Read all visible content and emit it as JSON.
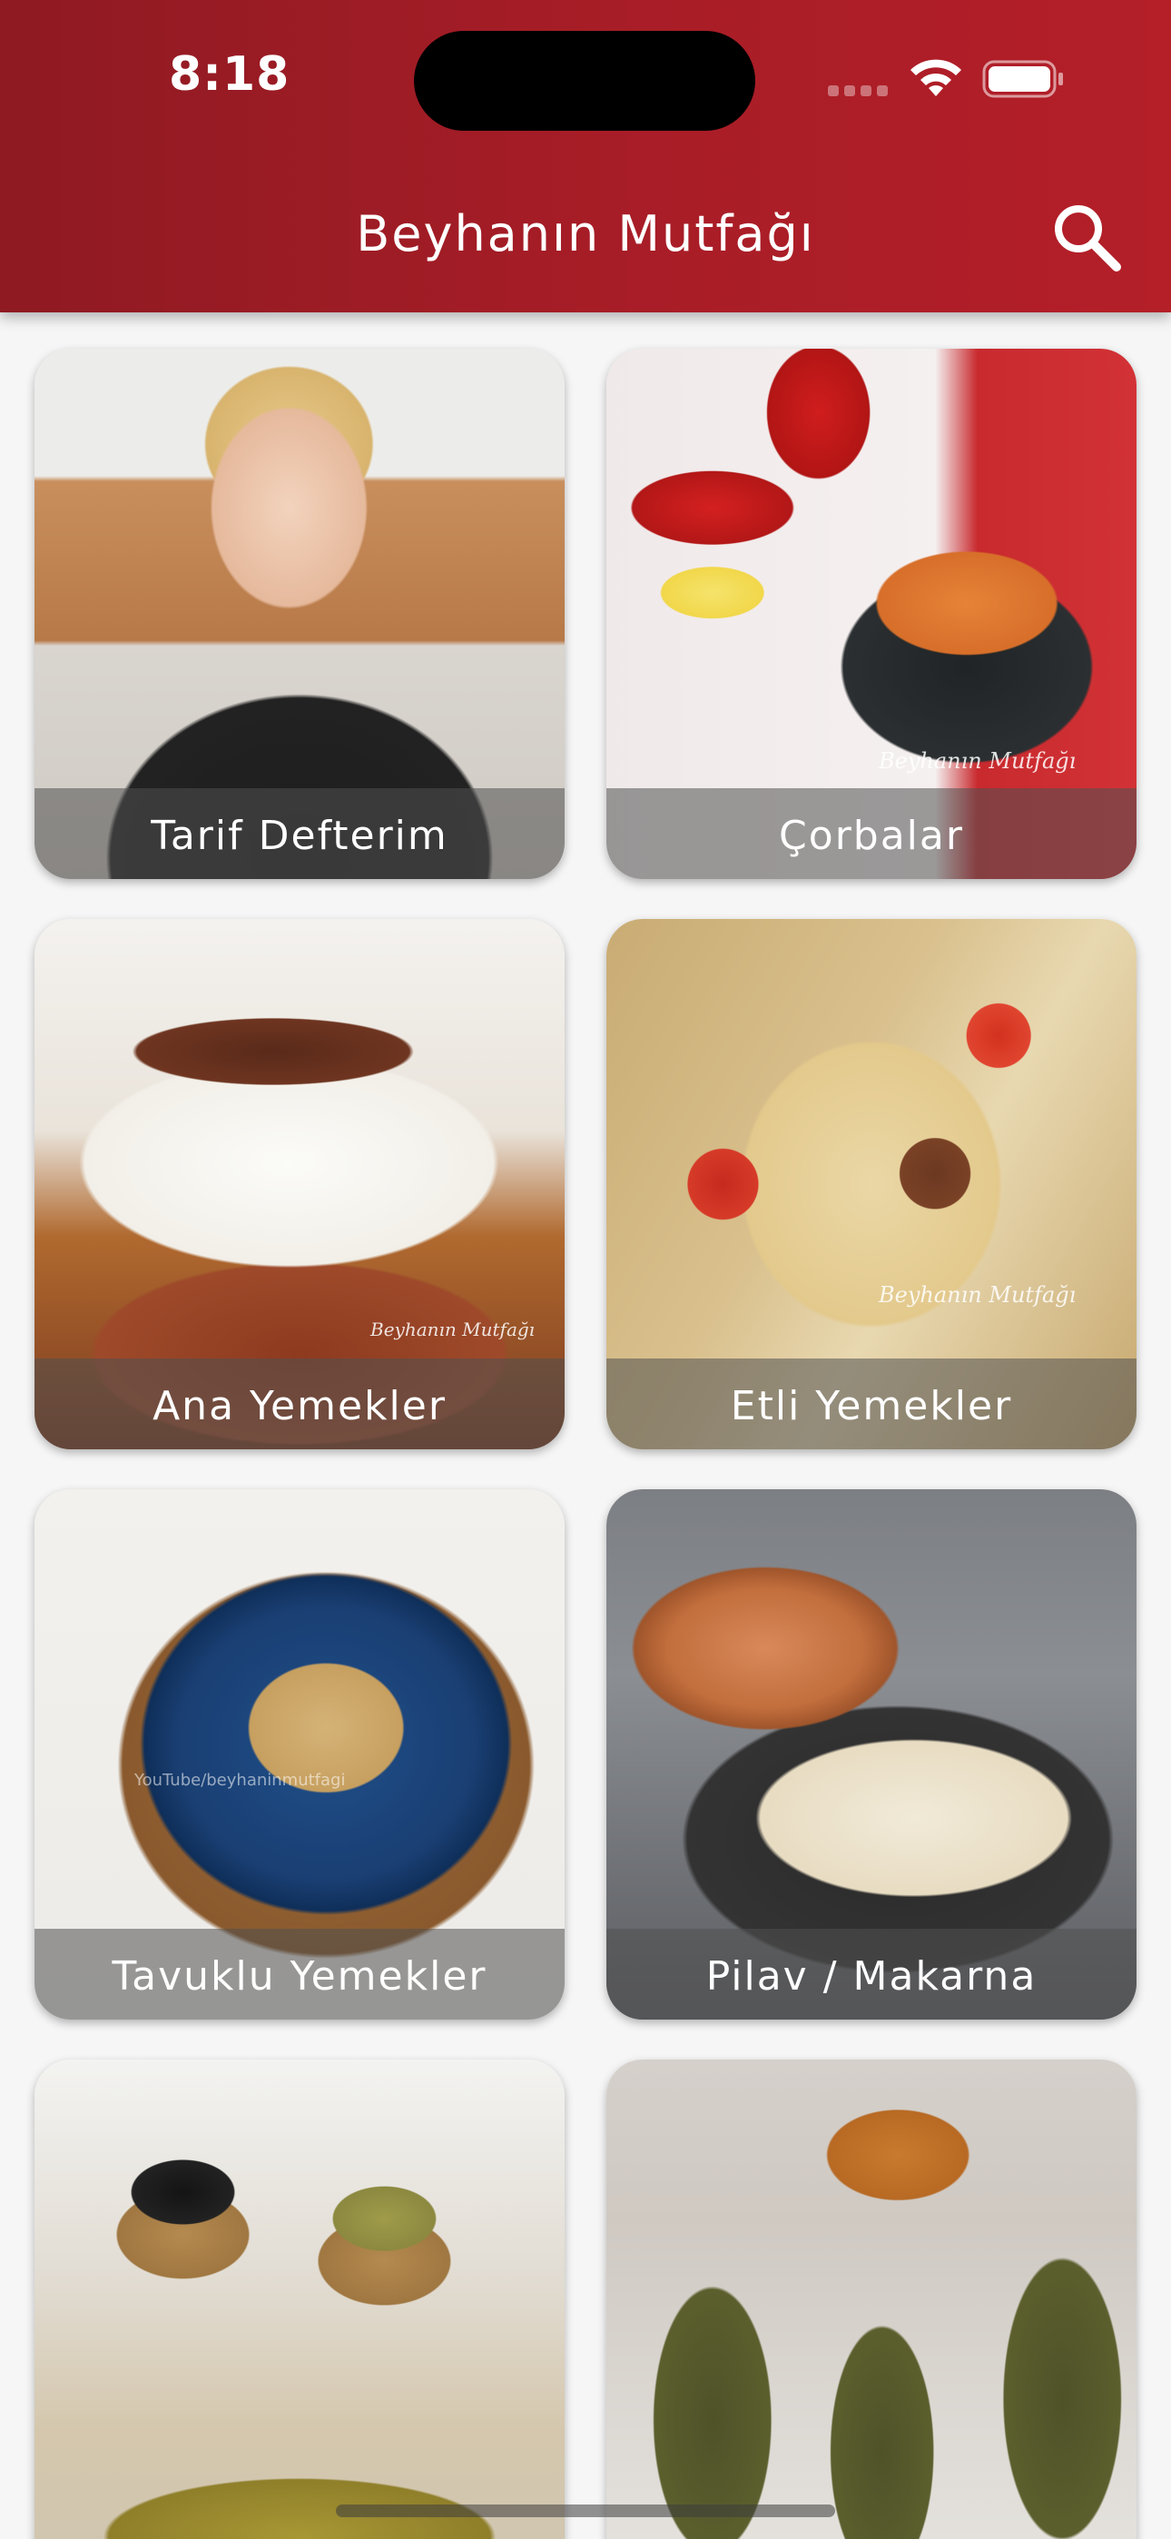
{
  "status_bar": {
    "time": "8:18"
  },
  "header": {
    "title": "Beyhanın Mutfağı",
    "search_icon": "search-icon"
  },
  "categories": [
    {
      "label": "Tarif Defterim",
      "image": "chef-portrait"
    },
    {
      "label": "Çorbalar",
      "image": "soup-bowl",
      "watermark": "Beyhanın Mutfağı"
    },
    {
      "label": "Ana Yemekler",
      "image": "main-dish",
      "watermark": "Beyhanın Mutfağı"
    },
    {
      "label": "Etli Yemekler",
      "image": "meat-rolls",
      "watermark": "Beyhanın Mutfağı"
    },
    {
      "label": "Tavuklu Yemekler",
      "image": "chicken-dish",
      "watermark": "YouTube/beyhaninmutfagi"
    },
    {
      "label": "Pilav / Makarna",
      "image": "rice-pilaf"
    },
    {
      "label": "",
      "image": "olives-oil"
    },
    {
      "label": "",
      "image": "stuffed-leaves"
    }
  ]
}
